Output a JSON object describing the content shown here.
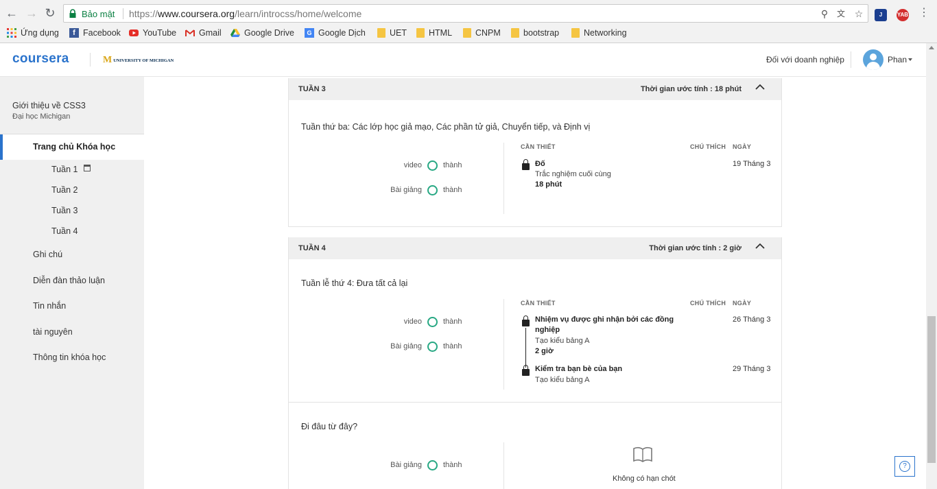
{
  "browser": {
    "secure_label": "Bảo mật",
    "url_scheme": "https://",
    "url_host": "www.coursera.org",
    "url_path": "/learn/introcss/home/welcome",
    "ext_label": "YAB",
    "bookmarks": [
      {
        "label": "Ứng dụng",
        "icon": "apps-icon"
      },
      {
        "label": "Facebook",
        "icon": "facebook-icon"
      },
      {
        "label": "YouTube",
        "icon": "youtube-icon"
      },
      {
        "label": "Gmail",
        "icon": "gmail-icon"
      },
      {
        "label": "Google Drive",
        "icon": "drive-icon"
      },
      {
        "label": "Google Dịch",
        "icon": "translate-icon"
      },
      {
        "label": "UET",
        "icon": "folder-icon"
      },
      {
        "label": "HTML",
        "icon": "folder-icon"
      },
      {
        "label": "CNPM",
        "icon": "folder-icon"
      },
      {
        "label": "bootstrap",
        "icon": "folder-icon"
      },
      {
        "label": "Networking",
        "icon": "folder-icon"
      }
    ]
  },
  "header": {
    "logo": "coursera",
    "university_mark": "M",
    "university_text": "UNIVERSITY OF MICHIGAN",
    "business_link": "Đối với doanh nghiệp",
    "username": "Phan"
  },
  "sidebar": {
    "course_title": "Giới thiệu về CSS3",
    "course_university": "Đại học Michigan",
    "home_label": "Trang chủ Khóa học",
    "weeks": [
      "Tuần 1",
      "Tuần 2",
      "Tuần 3",
      "Tuần 4"
    ],
    "items": [
      "Ghi chú",
      "Diễn đàn thảo luận",
      "Tin nhắn",
      "tài nguyên",
      "Thông tin khóa học"
    ]
  },
  "week3": {
    "label": "TUẦN 3",
    "estimate": "Thời gian ước tính : 18 phút",
    "description": "Tuần thứ ba: Các lớp học giả mạo, Các phần tử giả, Chuyển tiếp, và Định vị",
    "stats": [
      {
        "label": "video",
        "value": "thành"
      },
      {
        "label": "Bài giảng",
        "value": "thành"
      }
    ],
    "col_required": "CẦN THIẾT",
    "col_note": "CHÚ THÍCH",
    "col_date": "NGÀY",
    "items": [
      {
        "title": "Đố",
        "subtitle": "Trắc nghiệm cuối cùng",
        "duration": "18 phút",
        "date": "19 Tháng 3"
      }
    ]
  },
  "week4": {
    "label": "TUẦN 4",
    "estimate": "Thời gian ước tính : 2 giờ",
    "description": "Tuần lễ thứ 4: Đưa tất cả lại",
    "stats": [
      {
        "label": "video",
        "value": "thành"
      },
      {
        "label": "Bài giảng",
        "value": "thành"
      }
    ],
    "col_required": "CẦN THIẾT",
    "col_note": "CHÚ THÍCH",
    "col_date": "NGÀY",
    "items": [
      {
        "title": "Nhiệm vụ được ghi nhận bởi các đồng nghiệp",
        "subtitle": "Tạo kiểu bảng A",
        "duration": "2 giờ",
        "date": "26 Tháng 3"
      },
      {
        "title": "Kiểm tra bạn bè của bạn",
        "subtitle": "Tạo kiểu bảng A",
        "duration": "",
        "date": "29 Tháng 3"
      }
    ]
  },
  "where_next": {
    "title": "Đi đâu từ đây?",
    "stat_label": "Bài giảng",
    "stat_value": "thành",
    "no_deadline": "Không có hạn chót"
  },
  "help": {
    "label": "?"
  },
  "colors": {
    "accent": "#2a73cc",
    "complete": "#27a883",
    "secure": "#0b8043"
  }
}
